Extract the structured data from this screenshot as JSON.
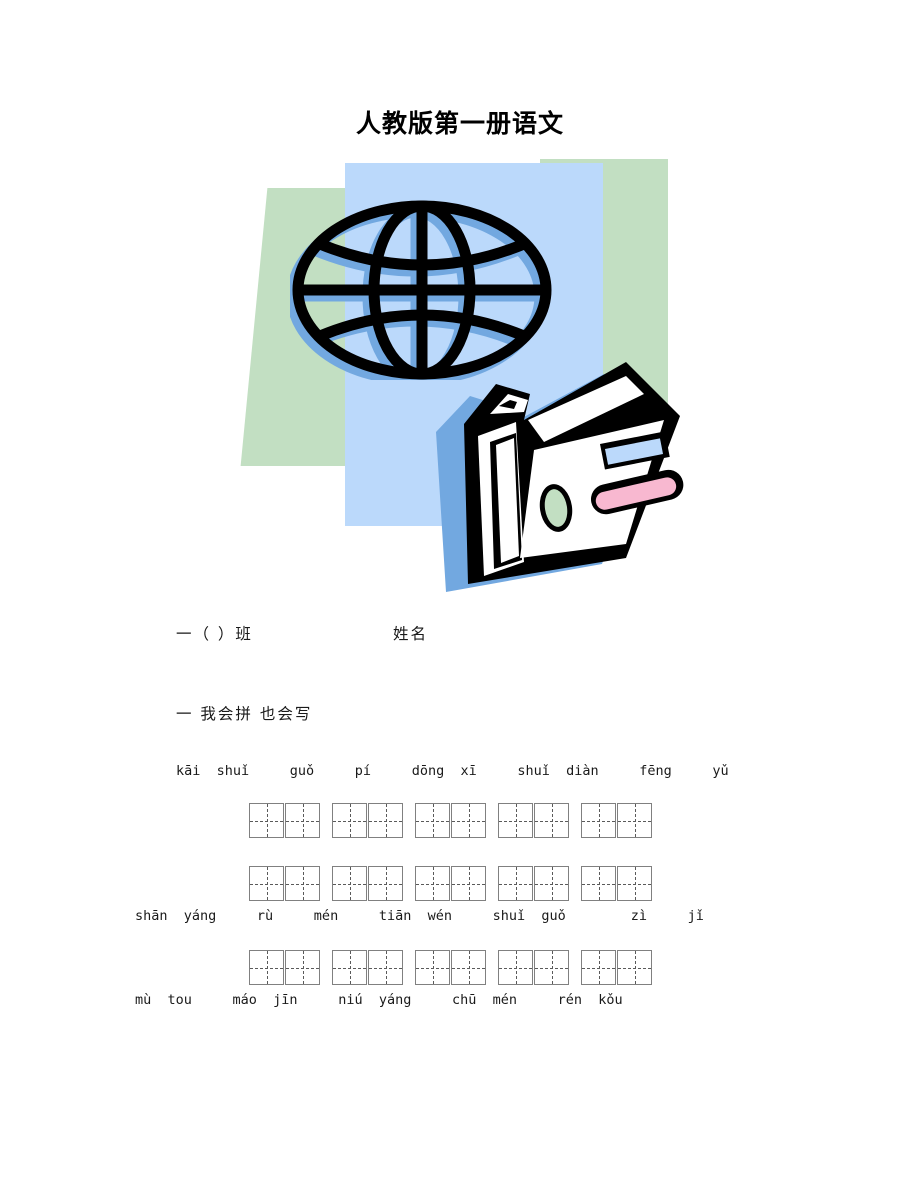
{
  "document": {
    "title": "人教版第一册语文",
    "class_line": "一（  ）班",
    "name_line": "姓名",
    "section_heading": "一  我会拼  也会写"
  },
  "clipart": {
    "name": "globe-and-briefcase-clipart",
    "colors": {
      "light_blue": "#bbd9fb",
      "medium_blue": "#72a8e0",
      "green": "#c2dfc2",
      "pink": "#f8b8d0",
      "black": "#000000",
      "white": "#ffffff"
    }
  },
  "exercise": {
    "rows": [
      {
        "id": "row-1",
        "pinyin_position": "above",
        "pinyin": [
          "kāi",
          "shuǐ",
          "guǒ",
          "pí",
          "dōng",
          "xī",
          "shuǐ",
          "diàn",
          "fēng",
          "yǔ"
        ],
        "pinyin_line": "kāi  shuǐ     guǒ     pí     dōng  xī     shuǐ  diàn     fēng     yǔ",
        "groups": 5,
        "cells_per_group": 2
      },
      {
        "id": "row-2",
        "pinyin_position": "below",
        "pinyin": [
          "shān",
          "yáng",
          "rù",
          "mén",
          "tiān",
          "wén",
          "shuǐ",
          "guǒ",
          "zì",
          "jǐ"
        ],
        "pinyin_line": "shān  yáng     rù     mén     tiān  wén     shuǐ  guǒ        zì     jǐ",
        "groups": 5,
        "cells_per_group": 2
      },
      {
        "id": "row-3",
        "pinyin_position": "below",
        "pinyin": [
          "mù",
          "tou",
          "máo",
          "jīn",
          "niú",
          "yáng",
          "chū",
          "mén",
          "rén",
          "kǒu"
        ],
        "pinyin_line": "mù  tou     máo  jīn     niú  yáng     chū  mén     rén  kǒu",
        "groups": 5,
        "cells_per_group": 2
      }
    ]
  }
}
